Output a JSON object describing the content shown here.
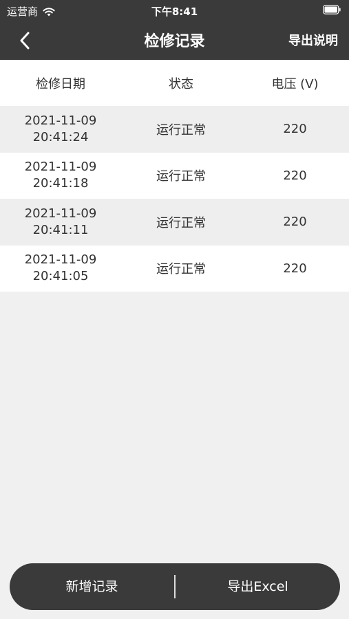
{
  "status_bar": {
    "carrier": "运营商",
    "time": "下午8:41"
  },
  "nav": {
    "title": "检修记录",
    "right_action": "导出说明"
  },
  "table": {
    "headers": [
      "检修日期",
      "状态",
      "电压 (V)"
    ],
    "rows": [
      {
        "date": "2021-11-09",
        "time": "20:41:24",
        "status": "运行正常",
        "voltage": "220"
      },
      {
        "date": "2021-11-09",
        "time": "20:41:18",
        "status": "运行正常",
        "voltage": "220"
      },
      {
        "date": "2021-11-09",
        "time": "20:41:11",
        "status": "运行正常",
        "voltage": "220"
      },
      {
        "date": "2021-11-09",
        "time": "20:41:05",
        "status": "运行正常",
        "voltage": "220"
      }
    ]
  },
  "bottom_bar": {
    "add_label": "新增记录",
    "export_label": "导出Excel"
  }
}
